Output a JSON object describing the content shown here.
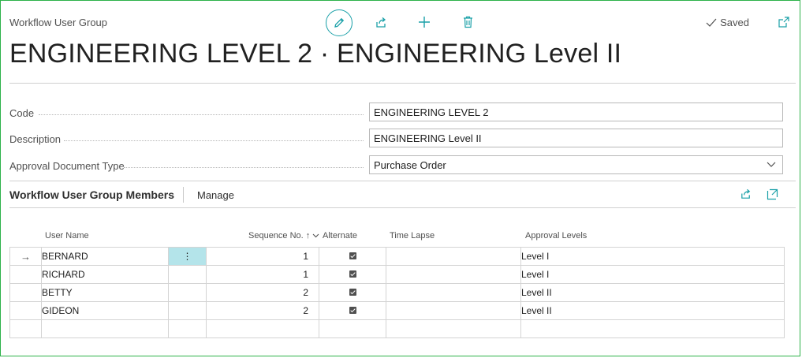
{
  "header": {
    "breadcrumb": "Workflow User Group",
    "status": "Saved",
    "title": "ENGINEERING LEVEL 2 · ENGINEERING Level II",
    "icons": [
      "pencil-icon",
      "share-icon",
      "plus-icon",
      "trash-icon",
      "checkmark-icon",
      "popout-icon"
    ]
  },
  "fields": {
    "code_label": "Code",
    "code_value": "ENGINEERING LEVEL 2",
    "description_label": "Description",
    "description_value": "ENGINEERING Level II",
    "doc_type_label": "Approval Document Type",
    "doc_type_value": "Purchase Order"
  },
  "members": {
    "title": "Workflow User Group Members",
    "manage_label": "Manage",
    "columns": {
      "user_name": "User Name",
      "sequence_no": "Sequence No.",
      "alternate": "Alternate",
      "time_lapse": "Time Lapse",
      "approval_levels": "Approval Levels"
    },
    "rows": [
      {
        "user_name": "BERNARD",
        "sequence_no": "1",
        "alternate": true,
        "time_lapse": "",
        "approval_levels": "Level I"
      },
      {
        "user_name": "RICHARD",
        "sequence_no": "1",
        "alternate": true,
        "time_lapse": "",
        "approval_levels": "Level I"
      },
      {
        "user_name": "BETTY",
        "sequence_no": "2",
        "alternate": true,
        "time_lapse": "",
        "approval_levels": "Level II"
      },
      {
        "user_name": "GIDEON",
        "sequence_no": "2",
        "alternate": true,
        "time_lapse": "",
        "approval_levels": "Level II"
      }
    ]
  },
  "colors": {
    "accent": "#1aa0a8",
    "frame_border": "#2db24a",
    "selected_cell": "#b4e4ea"
  }
}
